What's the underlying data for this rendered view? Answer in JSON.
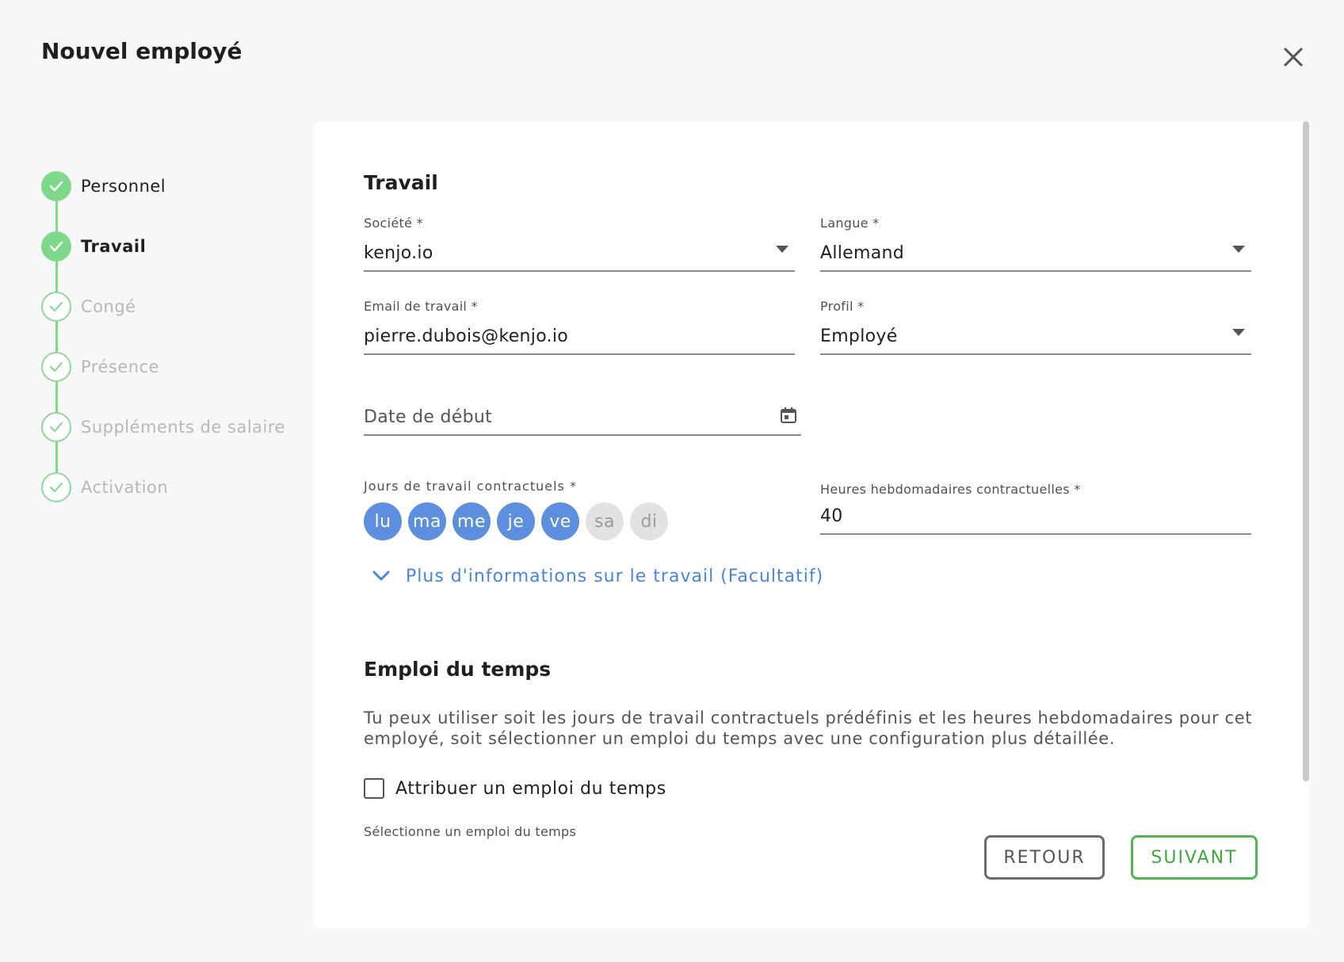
{
  "modal": {
    "title": "Nouvel employé"
  },
  "stepper": {
    "steps": [
      {
        "label": "Personnel",
        "state": "done"
      },
      {
        "label": "Travail",
        "state": "active"
      },
      {
        "label": "Congé",
        "state": "todo"
      },
      {
        "label": "Présence",
        "state": "todo"
      },
      {
        "label": "Suppléments de salaire",
        "state": "todo"
      },
      {
        "label": "Activation",
        "state": "todo"
      }
    ]
  },
  "travail": {
    "title": "Travail",
    "societe": {
      "label": "Société *",
      "value": "kenjo.io"
    },
    "langue": {
      "label": "Langue *",
      "value": "Allemand"
    },
    "email": {
      "label": "Email de travail *",
      "value": "pierre.dubois@kenjo.io"
    },
    "profil": {
      "label": "Profil *",
      "value": "Employé"
    },
    "date_debut": {
      "placeholder": "Date de début"
    },
    "jours": {
      "label": "Jours de travail contractuels *",
      "days": [
        {
          "label": "lu",
          "selected": true
        },
        {
          "label": "ma",
          "selected": true
        },
        {
          "label": "me",
          "selected": true
        },
        {
          "label": "je",
          "selected": true
        },
        {
          "label": "ve",
          "selected": true
        },
        {
          "label": "sa",
          "selected": false
        },
        {
          "label": "di",
          "selected": false
        }
      ]
    },
    "heures": {
      "label": "Heures hebdomadaires contractuelles *",
      "value": "40"
    },
    "more_info": "Plus d'informations sur le travail (Facultatif)"
  },
  "emploi": {
    "title": "Emploi du temps",
    "description": "Tu peux utiliser soit les jours de travail contractuels prédéfinis et les heures hebdomadaires pour cet employé, soit sélectionner un emploi du temps avec une configuration plus détaillée.",
    "checkbox_label": "Attribuer un emploi du temps",
    "select_hint": "Sélectionne un emploi du temps"
  },
  "actions": {
    "back": "RETOUR",
    "next": "SUIVANT"
  },
  "colors": {
    "step_green": "#7fd98a",
    "day_blue": "#5c8fe0",
    "link_blue": "#4a86d8",
    "next_green": "#4cb84f"
  }
}
